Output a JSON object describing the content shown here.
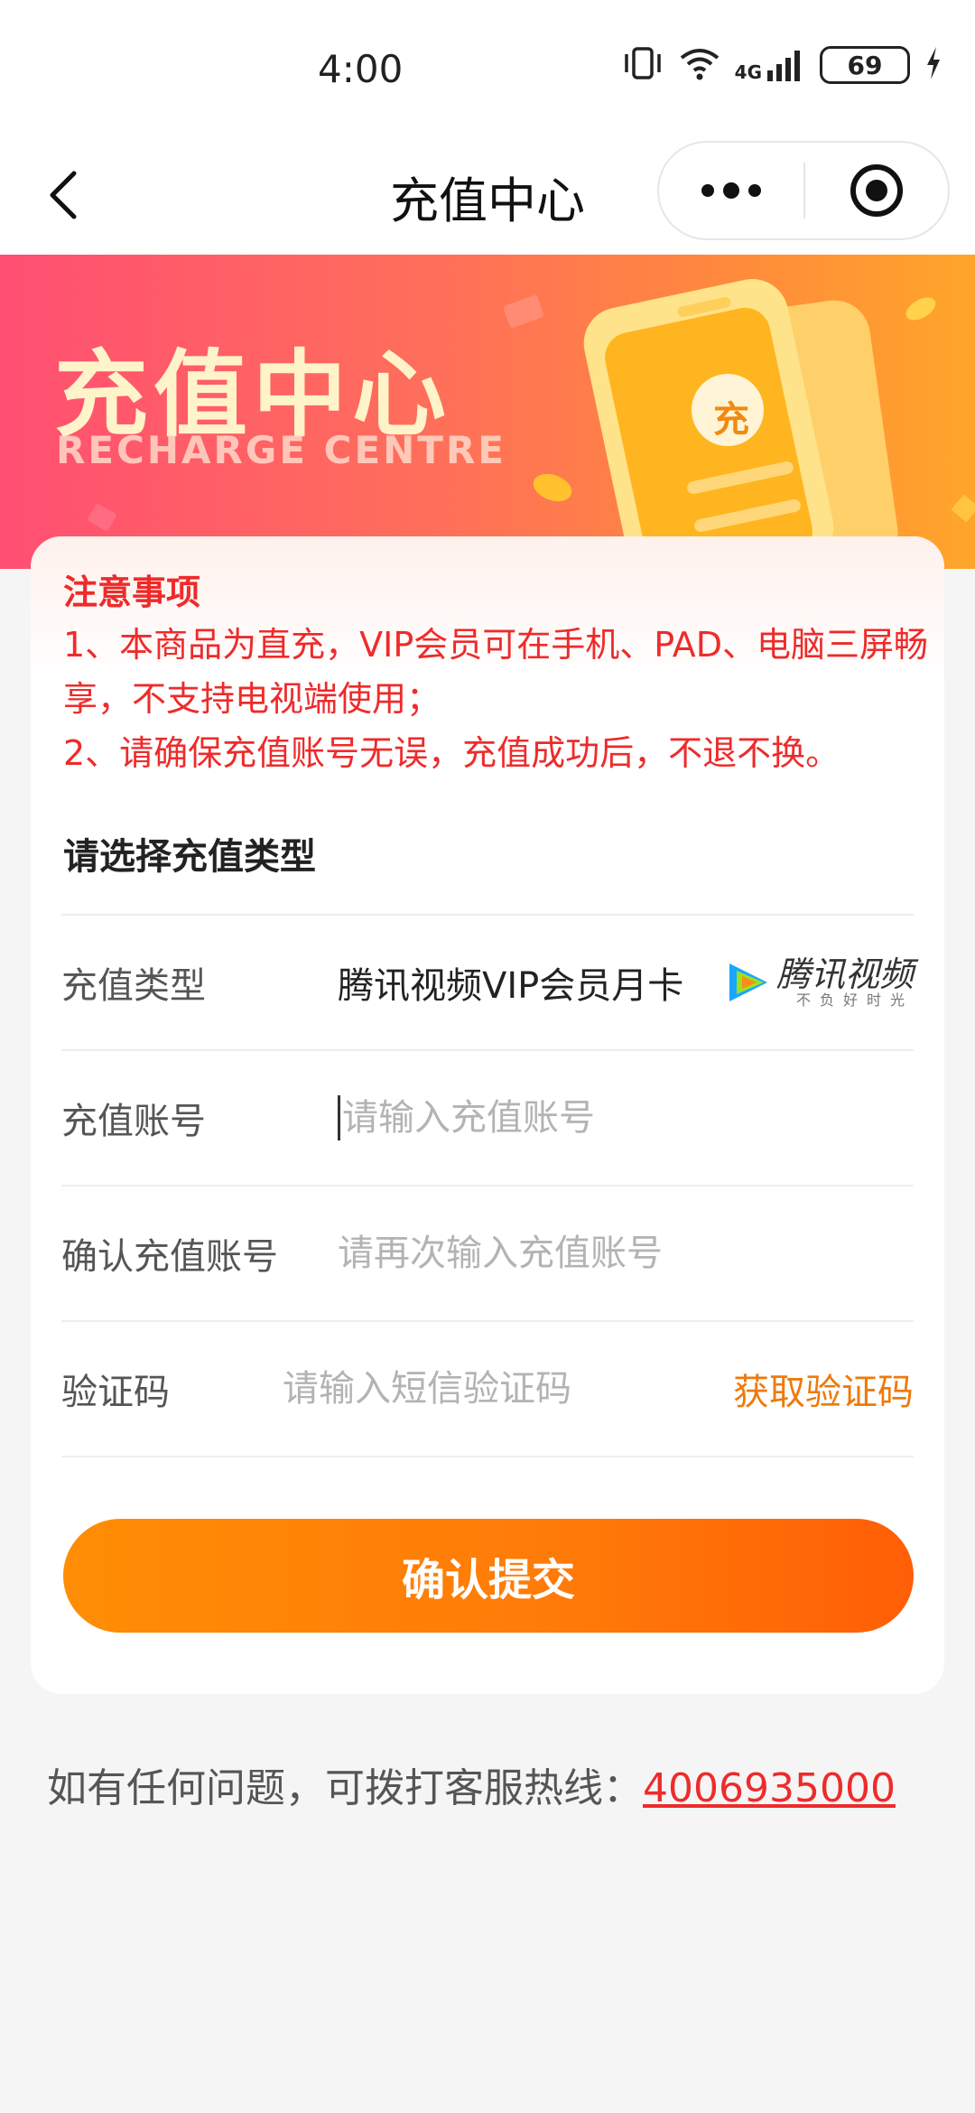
{
  "status_bar": {
    "time": "4:00",
    "network": "4G",
    "battery": "69"
  },
  "nav": {
    "title": "充值中心",
    "back_icon": "chevron-left-icon",
    "more_icon": "more-dots-icon",
    "close_icon": "target-circle-icon"
  },
  "banner": {
    "title": "充值中心",
    "subtitle": "RECHARGE CENTRE",
    "badge": "充"
  },
  "notice": {
    "title": "注意事项",
    "lines": [
      "1、本商品为直充，VIP会员可在手机、PAD、电脑三屏畅享，不支持电视端使用；",
      "2、请确保充值账号无误，充值成功后，不退不换。"
    ]
  },
  "form": {
    "section_title": "请选择充值类型",
    "type_label": "充值类型",
    "type_value": "腾讯视频VIP会员月卡",
    "brand_name": "腾讯视频",
    "brand_slogan": "不负好时光",
    "account_label": "充值账号",
    "account_placeholder": "请输入充值账号",
    "confirm_label": "确认充值账号",
    "confirm_placeholder": "请再次输入充值账号",
    "code_label": "验证码",
    "code_placeholder": "请输入短信验证码",
    "get_code": "获取验证码",
    "submit": "确认提交"
  },
  "footer": {
    "hotline_text": "如有任何问题，可拨打客服热线：",
    "hotline_number": "4006935000"
  },
  "colors": {
    "accent": "#ff7a08",
    "notice_red": "#ee2b2b",
    "get_code_orange": "#ee7a0a"
  }
}
